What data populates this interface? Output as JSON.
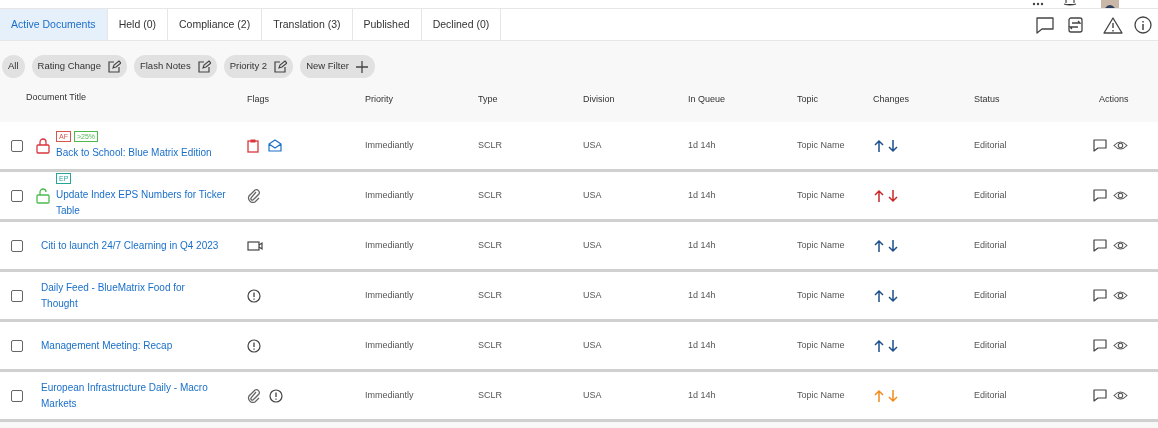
{
  "tabs": [
    {
      "label": "Active Documents",
      "selected": true
    },
    {
      "label": "Held (0)",
      "selected": false
    },
    {
      "label": "Compliance (2)",
      "selected": false
    },
    {
      "label": "Translation (3)",
      "selected": false
    },
    {
      "label": "Published",
      "selected": false
    },
    {
      "label": "Declined (0)",
      "selected": false
    }
  ],
  "filters": [
    {
      "label": "All",
      "kind": "plain"
    },
    {
      "label": "Rating Change",
      "kind": "edit"
    },
    {
      "label": "Flash Notes",
      "kind": "edit"
    },
    {
      "label": "Priority 2",
      "kind": "edit"
    },
    {
      "label": "New Filter",
      "kind": "add"
    }
  ],
  "table": {
    "columns": [
      "Document Title",
      "Flags",
      "Priority",
      "Type",
      "Division",
      "In Queue",
      "Topic",
      "Changes",
      "Status",
      "Actions"
    ],
    "rows": [
      {
        "checked": false,
        "lock": {
          "kind": "closed"
        },
        "tags": [
          {
            "text": "AF",
            "color": "#d9534f"
          },
          {
            "text": ">25%",
            "color": "#4cbb4c"
          }
        ],
        "title": "Back to School: Blue Matrix Edition",
        "flags": [
          {
            "kind": "clipboard"
          },
          {
            "kind": "mail"
          }
        ],
        "priority": "Immediantly",
        "type": "SCLR",
        "division": "USA",
        "in_queue": "1d 14h",
        "topic": "Topic Name",
        "changes": {
          "color": "#1d4f8c"
        },
        "status": "Editorial"
      },
      {
        "checked": false,
        "lock": {
          "kind": "open"
        },
        "tags": [
          {
            "text": "EP",
            "color": "#26a69a"
          }
        ],
        "title": "Update Index EPS Numbers for Ticker Table",
        "flags": [
          {
            "kind": "attachment"
          }
        ],
        "priority": "Immediantly",
        "type": "SCLR",
        "division": "USA",
        "in_queue": "1d 14h",
        "topic": "Topic Name",
        "changes": {
          "color": "#c62828"
        },
        "status": "Editorial"
      },
      {
        "checked": false,
        "title": "Citi to launch 24/7 Clearning in Q4 2023",
        "flags": [
          {
            "kind": "video"
          }
        ],
        "priority": "Immediantly",
        "type": "SCLR",
        "division": "USA",
        "in_queue": "1d 14h",
        "topic": "Topic Name",
        "changes": {
          "color": "#1d4f8c"
        },
        "status": "Editorial"
      },
      {
        "checked": false,
        "title": "Daily Feed - BlueMatrix Food for Thought",
        "flags": [
          {
            "kind": "alert"
          }
        ],
        "priority": "Immediantly",
        "type": "SCLR",
        "division": "USA",
        "in_queue": "1d 14h",
        "topic": "Topic Name",
        "changes": {
          "color": "#1d4f8c"
        },
        "status": "Editorial"
      },
      {
        "checked": false,
        "title": "Management Meeting: Recap",
        "flags": [
          {
            "kind": "alert"
          }
        ],
        "priority": "Immediantly",
        "type": "SCLR",
        "division": "USA",
        "in_queue": "1d 14h",
        "topic": "Topic Name",
        "changes": {
          "color": "#1d4f8c"
        },
        "status": "Editorial"
      },
      {
        "checked": false,
        "title": "European Infrastructure Daily - Macro Markets",
        "flags": [
          {
            "kind": "attachment"
          },
          {
            "kind": "alert"
          }
        ],
        "priority": "Immediantly",
        "type": "SCLR",
        "division": "USA",
        "in_queue": "1d 14h",
        "topic": "Topic Name",
        "changes": {
          "color": "#f08a1c"
        },
        "status": "Editorial"
      }
    ]
  }
}
